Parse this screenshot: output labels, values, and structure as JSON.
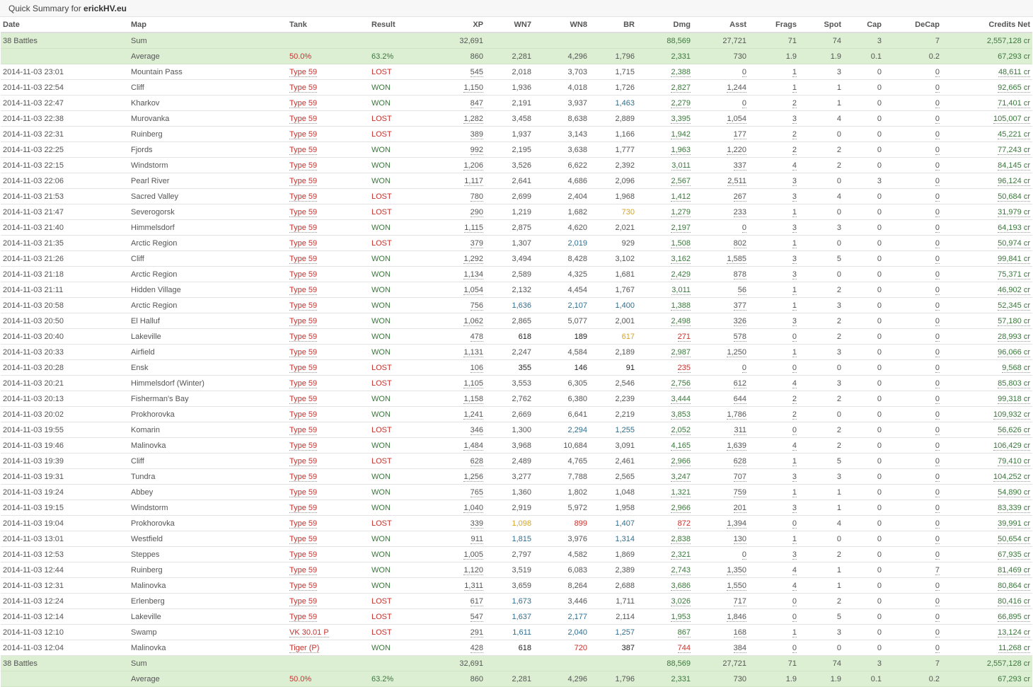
{
  "header": {
    "prefix": "Quick Summary for ",
    "player": "erickHV.eu"
  },
  "columns": [
    "Date",
    "Map",
    "Tank",
    "Result",
    "XP",
    "WN7",
    "WN8",
    "BR",
    "Dmg",
    "Asst",
    "Frags",
    "Spot",
    "Cap",
    "DeCap",
    "Credits Net"
  ],
  "summary": {
    "sum": [
      "38 Battles",
      "Sum",
      "",
      "",
      "32,691",
      "",
      "",
      "",
      "88,569",
      "27,721",
      "71",
      "74",
      "3",
      "7",
      "2,557,128 cr"
    ],
    "avg": [
      "",
      "Average",
      "50.0%",
      "63.2%",
      "860",
      "2,281",
      "4,296",
      "1,796",
      "2,331",
      "730",
      "1.9",
      "1.9",
      "0.1",
      "0.2",
      "67,293 cr"
    ]
  },
  "colors": {
    "red": "#c9302c",
    "green": "#3c763d",
    "blue": "#31708f",
    "orange": "#d9a41b",
    "black": "#222222",
    "aggregate_bg": "#dcefd3"
  },
  "battles": [
    [
      "2014-11-03 23:01",
      "Mountain Pass",
      "Type 59",
      "LOST",
      "545",
      "2,018",
      "3,703",
      "1,715",
      "2,388",
      "0",
      "1",
      "3",
      "0",
      "0",
      "48,611 cr"
    ],
    [
      "2014-11-03 22:54",
      "Cliff",
      "Type 59",
      "WON",
      "1,150",
      "1,936",
      "4,018",
      "1,726",
      "2,827",
      "1,244",
      "1",
      "1",
      "0",
      "0",
      "92,665 cr"
    ],
    [
      "2014-11-03 22:47",
      "Kharkov",
      "Type 59",
      "WON",
      "847",
      "2,191",
      "3,937",
      "1,463",
      "2,279",
      "0",
      "2",
      "1",
      "0",
      "0",
      "71,401 cr"
    ],
    [
      "2014-11-03 22:38",
      "Murovanka",
      "Type 59",
      "LOST",
      "1,282",
      "3,458",
      "8,638",
      "2,889",
      "3,395",
      "1,054",
      "3",
      "4",
      "0",
      "0",
      "105,007 cr"
    ],
    [
      "2014-11-03 22:31",
      "Ruinberg",
      "Type 59",
      "LOST",
      "389",
      "1,937",
      "3,143",
      "1,166",
      "1,942",
      "177",
      "2",
      "0",
      "0",
      "0",
      "45,221 cr"
    ],
    [
      "2014-11-03 22:25",
      "Fjords",
      "Type 59",
      "WON",
      "992",
      "2,195",
      "3,638",
      "1,777",
      "1,963",
      "1,220",
      "2",
      "2",
      "0",
      "0",
      "77,243 cr"
    ],
    [
      "2014-11-03 22:15",
      "Windstorm",
      "Type 59",
      "WON",
      "1,206",
      "3,526",
      "6,622",
      "2,392",
      "3,011",
      "337",
      "4",
      "2",
      "0",
      "0",
      "84,145 cr"
    ],
    [
      "2014-11-03 22:06",
      "Pearl River",
      "Type 59",
      "WON",
      "1,117",
      "2,641",
      "4,686",
      "2,096",
      "2,567",
      "2,511",
      "3",
      "0",
      "3",
      "0",
      "96,124 cr"
    ],
    [
      "2014-11-03 21:53",
      "Sacred Valley",
      "Type 59",
      "LOST",
      "780",
      "2,699",
      "2,404",
      "1,968",
      "1,412",
      "267",
      "3",
      "4",
      "0",
      "0",
      "50,684 cr"
    ],
    [
      "2014-11-03 21:47",
      "Severogorsk",
      "Type 59",
      "LOST",
      "290",
      "1,219",
      "1,682",
      "730",
      "1,279",
      "233",
      "1",
      "0",
      "0",
      "0",
      "31,979 cr"
    ],
    [
      "2014-11-03 21:40",
      "Himmelsdorf",
      "Type 59",
      "WON",
      "1,115",
      "2,875",
      "4,620",
      "2,021",
      "2,197",
      "0",
      "3",
      "3",
      "0",
      "0",
      "64,193 cr"
    ],
    [
      "2014-11-03 21:35",
      "Arctic Region",
      "Type 59",
      "LOST",
      "379",
      "1,307",
      "2,019",
      "929",
      "1,508",
      "802",
      "1",
      "0",
      "0",
      "0",
      "50,974 cr"
    ],
    [
      "2014-11-03 21:26",
      "Cliff",
      "Type 59",
      "WON",
      "1,292",
      "3,494",
      "8,428",
      "3,102",
      "3,162",
      "1,585",
      "3",
      "5",
      "0",
      "0",
      "99,841 cr"
    ],
    [
      "2014-11-03 21:18",
      "Arctic Region",
      "Type 59",
      "WON",
      "1,134",
      "2,589",
      "4,325",
      "1,681",
      "2,429",
      "878",
      "3",
      "0",
      "0",
      "0",
      "75,371 cr"
    ],
    [
      "2014-11-03 21:11",
      "Hidden Village",
      "Type 59",
      "WON",
      "1,054",
      "2,132",
      "4,454",
      "1,767",
      "3,011",
      "56",
      "1",
      "2",
      "0",
      "0",
      "46,902 cr"
    ],
    [
      "2014-11-03 20:58",
      "Arctic Region",
      "Type 59",
      "WON",
      "756",
      "1,636",
      "2,107",
      "1,400",
      "1,388",
      "377",
      "1",
      "3",
      "0",
      "0",
      "52,345 cr"
    ],
    [
      "2014-11-03 20:50",
      "El Halluf",
      "Type 59",
      "WON",
      "1,062",
      "2,865",
      "5,077",
      "2,001",
      "2,498",
      "326",
      "3",
      "2",
      "0",
      "0",
      "57,180 cr"
    ],
    [
      "2014-11-03 20:40",
      "Lakeville",
      "Type 59",
      "WON",
      "478",
      "618",
      "189",
      "617",
      "271",
      "578",
      "0",
      "2",
      "0",
      "0",
      "28,993 cr"
    ],
    [
      "2014-11-03 20:33",
      "Airfield",
      "Type 59",
      "WON",
      "1,131",
      "2,247",
      "4,584",
      "2,189",
      "2,987",
      "1,250",
      "1",
      "3",
      "0",
      "0",
      "96,066 cr"
    ],
    [
      "2014-11-03 20:28",
      "Ensk",
      "Type 59",
      "LOST",
      "106",
      "355",
      "146",
      "91",
      "235",
      "0",
      "0",
      "0",
      "0",
      "0",
      "9,568 cr"
    ],
    [
      "2014-11-03 20:21",
      "Himmelsdorf (Winter)",
      "Type 59",
      "LOST",
      "1,105",
      "3,553",
      "6,305",
      "2,546",
      "2,756",
      "612",
      "4",
      "3",
      "0",
      "0",
      "85,803 cr"
    ],
    [
      "2014-11-03 20:13",
      "Fisherman's Bay",
      "Type 59",
      "WON",
      "1,158",
      "2,762",
      "6,380",
      "2,239",
      "3,444",
      "644",
      "2",
      "2",
      "0",
      "0",
      "99,318 cr"
    ],
    [
      "2014-11-03 20:02",
      "Prokhorovka",
      "Type 59",
      "WON",
      "1,241",
      "2,669",
      "6,641",
      "2,219",
      "3,853",
      "1,786",
      "2",
      "0",
      "0",
      "0",
      "109,932 cr"
    ],
    [
      "2014-11-03 19:55",
      "Komarin",
      "Type 59",
      "LOST",
      "346",
      "1,300",
      "2,294",
      "1,255",
      "2,052",
      "311",
      "0",
      "2",
      "0",
      "0",
      "56,626 cr"
    ],
    [
      "2014-11-03 19:46",
      "Malinovka",
      "Type 59",
      "WON",
      "1,484",
      "3,968",
      "10,684",
      "3,091",
      "4,165",
      "1,639",
      "4",
      "2",
      "0",
      "0",
      "106,429 cr"
    ],
    [
      "2014-11-03 19:39",
      "Cliff",
      "Type 59",
      "LOST",
      "628",
      "2,489",
      "4,765",
      "2,461",
      "2,966",
      "628",
      "1",
      "5",
      "0",
      "0",
      "79,410 cr"
    ],
    [
      "2014-11-03 19:31",
      "Tundra",
      "Type 59",
      "WON",
      "1,256",
      "3,277",
      "7,788",
      "2,565",
      "3,247",
      "707",
      "3",
      "3",
      "0",
      "0",
      "104,252 cr"
    ],
    [
      "2014-11-03 19:24",
      "Abbey",
      "Type 59",
      "WON",
      "765",
      "1,360",
      "1,802",
      "1,048",
      "1,321",
      "759",
      "1",
      "1",
      "0",
      "0",
      "54,890 cr"
    ],
    [
      "2014-11-03 19:15",
      "Windstorm",
      "Type 59",
      "WON",
      "1,040",
      "2,919",
      "5,972",
      "1,958",
      "2,966",
      "201",
      "3",
      "1",
      "0",
      "0",
      "83,339 cr"
    ],
    [
      "2014-11-03 19:04",
      "Prokhorovka",
      "Type 59",
      "LOST",
      "339",
      "1,098",
      "899",
      "1,407",
      "872",
      "1,394",
      "0",
      "4",
      "0",
      "0",
      "39,991 cr"
    ],
    [
      "2014-11-03 13:01",
      "Westfield",
      "Type 59",
      "WON",
      "911",
      "1,815",
      "3,976",
      "1,314",
      "2,838",
      "130",
      "1",
      "0",
      "0",
      "0",
      "50,654 cr"
    ],
    [
      "2014-11-03 12:53",
      "Steppes",
      "Type 59",
      "WON",
      "1,005",
      "2,797",
      "4,582",
      "1,869",
      "2,321",
      "0",
      "3",
      "2",
      "0",
      "0",
      "67,935 cr"
    ],
    [
      "2014-11-03 12:44",
      "Ruinberg",
      "Type 59",
      "WON",
      "1,120",
      "3,519",
      "6,083",
      "2,389",
      "2,743",
      "1,350",
      "4",
      "1",
      "0",
      "7",
      "81,469 cr"
    ],
    [
      "2014-11-03 12:31",
      "Malinovka",
      "Type 59",
      "WON",
      "1,311",
      "3,659",
      "8,264",
      "2,688",
      "3,686",
      "1,550",
      "4",
      "1",
      "0",
      "0",
      "80,864 cr"
    ],
    [
      "2014-11-03 12:24",
      "Erlenberg",
      "Type 59",
      "LOST",
      "617",
      "1,673",
      "3,446",
      "1,711",
      "3,026",
      "717",
      "0",
      "2",
      "0",
      "0",
      "80,416 cr"
    ],
    [
      "2014-11-03 12:14",
      "Lakeville",
      "Type 59",
      "LOST",
      "547",
      "1,637",
      "2,177",
      "2,114",
      "1,953",
      "1,846",
      "0",
      "5",
      "0",
      "0",
      "66,895 cr"
    ],
    [
      "2014-11-03 12:10",
      "Swamp",
      "VK 30.01 P",
      "LOST",
      "291",
      "1,611",
      "2,040",
      "1,257",
      "867",
      "168",
      "1",
      "3",
      "0",
      "0",
      "13,124 cr"
    ],
    [
      "2014-11-03 12:04",
      "Malinovka",
      "Tiger (P)",
      "WON",
      "428",
      "618",
      "720",
      "387",
      "744",
      "384",
      "0",
      "0",
      "0",
      "0",
      "11,268 cr"
    ]
  ],
  "battle_colors": [
    [
      "g",
      "g",
      "g",
      "g",
      "g"
    ],
    [
      "g",
      "g",
      "g",
      "g",
      "g"
    ],
    [
      "g",
      "g",
      "g",
      "b",
      "g"
    ],
    [
      "g",
      "g",
      "g",
      "g",
      "g"
    ],
    [
      "g",
      "g",
      "g",
      "g",
      "g"
    ],
    [
      "g",
      "g",
      "g",
      "g",
      "g"
    ],
    [
      "g",
      "g",
      "g",
      "g",
      "g"
    ],
    [
      "g",
      "g",
      "g",
      "g",
      "g"
    ],
    [
      "g",
      "g",
      "g",
      "g",
      "g"
    ],
    [
      "g",
      "g",
      "g",
      "o",
      "g"
    ],
    [
      "g",
      "g",
      "g",
      "g",
      "g"
    ],
    [
      "g",
      "g",
      "b",
      "g",
      "g"
    ],
    [
      "g",
      "g",
      "g",
      "g",
      "g"
    ],
    [
      "g",
      "g",
      "g",
      "g",
      "g"
    ],
    [
      "g",
      "g",
      "g",
      "g",
      "g"
    ],
    [
      "g",
      "b",
      "b",
      "b",
      "g"
    ],
    [
      "g",
      "g",
      "g",
      "g",
      "g"
    ],
    [
      "g",
      "k",
      "k",
      "o",
      "r"
    ],
    [
      "g",
      "g",
      "g",
      "g",
      "g"
    ],
    [
      "g",
      "k",
      "k",
      "k",
      "r"
    ],
    [
      "g",
      "g",
      "g",
      "g",
      "g"
    ],
    [
      "g",
      "g",
      "g",
      "g",
      "g"
    ],
    [
      "g",
      "g",
      "g",
      "g",
      "g"
    ],
    [
      "g",
      "g",
      "b",
      "b",
      "g"
    ],
    [
      "g",
      "g",
      "g",
      "g",
      "g"
    ],
    [
      "g",
      "g",
      "g",
      "g",
      "g"
    ],
    [
      "g",
      "g",
      "g",
      "g",
      "g"
    ],
    [
      "g",
      "g",
      "g",
      "g",
      "g"
    ],
    [
      "g",
      "g",
      "g",
      "g",
      "g"
    ],
    [
      "g",
      "o",
      "r",
      "b",
      "r"
    ],
    [
      "g",
      "b",
      "g",
      "b",
      "g"
    ],
    [
      "g",
      "g",
      "g",
      "g",
      "g"
    ],
    [
      "g",
      "g",
      "g",
      "g",
      "g"
    ],
    [
      "g",
      "g",
      "g",
      "g",
      "g"
    ],
    [
      "g",
      "b",
      "g",
      "g",
      "g"
    ],
    [
      "g",
      "b",
      "b",
      "g",
      "g"
    ],
    [
      "g",
      "b",
      "b",
      "b",
      "g"
    ],
    [
      "g",
      "k",
      "r",
      "k",
      "r"
    ]
  ]
}
